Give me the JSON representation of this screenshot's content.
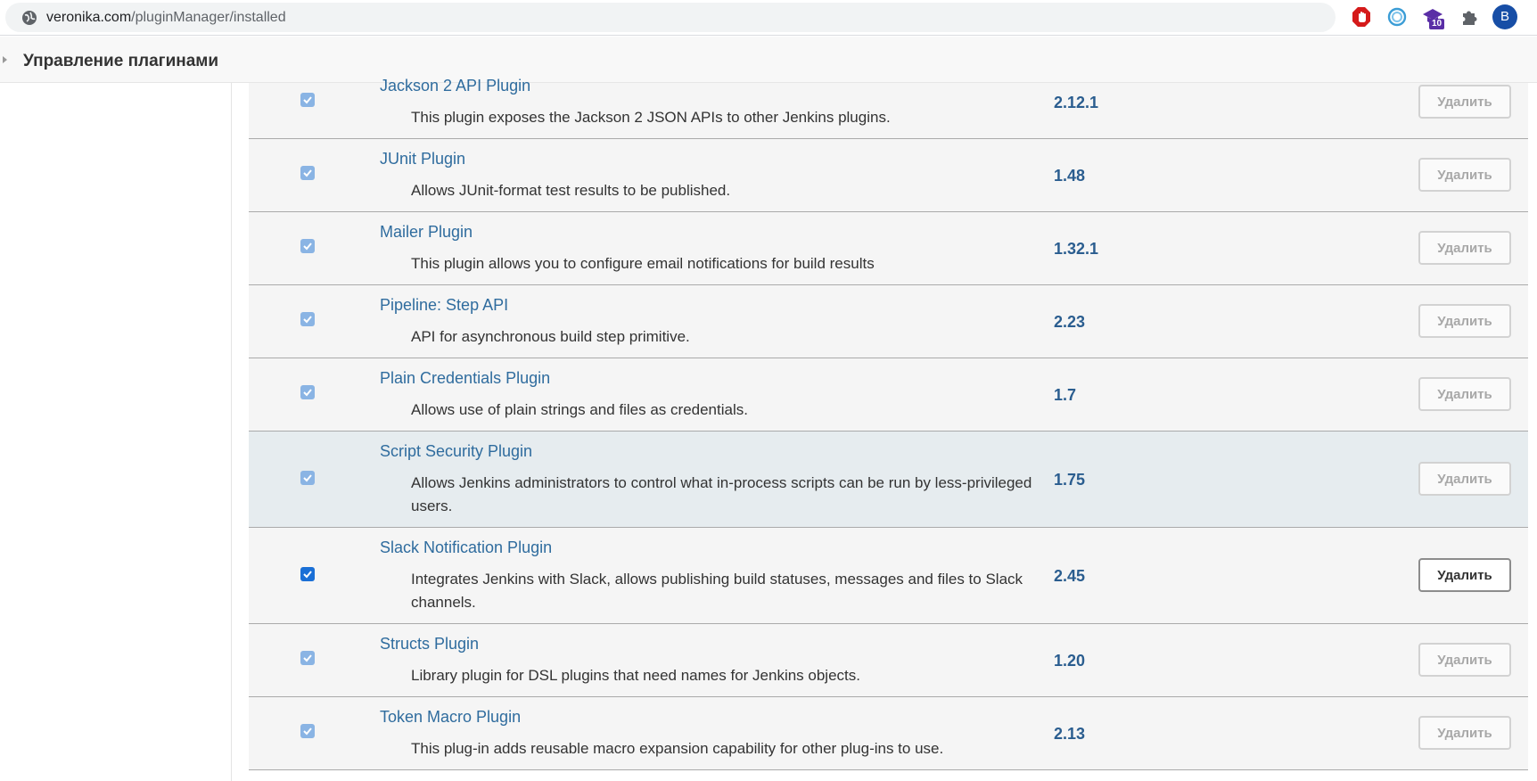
{
  "browser": {
    "url_host": "veronika.com",
    "url_path": "/pluginManager/installed",
    "ext_badge": "10",
    "profile_initial": "B"
  },
  "header": {
    "title": "Управление плагинами"
  },
  "plugins": [
    {
      "name": "Jackson 2 API Plugin",
      "description": "This plugin exposes the Jackson 2 JSON APIs to other Jenkins plugins.",
      "version": "2.12.1",
      "uninstall_label": "Удалить",
      "checked": true,
      "enabled": false
    },
    {
      "name": "JUnit Plugin",
      "description": "Allows JUnit-format test results to be published.",
      "version": "1.48",
      "uninstall_label": "Удалить",
      "checked": true,
      "enabled": false
    },
    {
      "name": "Mailer Plugin",
      "description": "This plugin allows you to configure email notifications for build results",
      "version": "1.32.1",
      "uninstall_label": "Удалить",
      "checked": true,
      "enabled": false
    },
    {
      "name": "Pipeline: Step API",
      "description": "API for asynchronous build step primitive.",
      "version": "2.23",
      "uninstall_label": "Удалить",
      "checked": true,
      "enabled": false
    },
    {
      "name": "Plain Credentials Plugin",
      "description": "Allows use of plain strings and files as credentials.",
      "version": "1.7",
      "uninstall_label": "Удалить",
      "checked": true,
      "enabled": false
    },
    {
      "name": "Script Security Plugin",
      "description": "Allows Jenkins administrators to control what in-process scripts can be run by less-privileged users.",
      "version": "1.75",
      "uninstall_label": "Удалить",
      "checked": true,
      "enabled": false
    },
    {
      "name": "Slack Notification Plugin",
      "description": "Integrates Jenkins with Slack, allows publishing build statuses, messages and files to Slack channels.",
      "version": "2.45",
      "uninstall_label": "Удалить",
      "checked": true,
      "enabled": true
    },
    {
      "name": "Structs Plugin",
      "description": "Library plugin for DSL plugins that need names for Jenkins objects.",
      "version": "1.20",
      "uninstall_label": "Удалить",
      "checked": true,
      "enabled": false
    },
    {
      "name": "Token Macro Plugin",
      "description": "This plug-in adds reusable macro expansion capability for other plug-ins to use.",
      "version": "2.13",
      "uninstall_label": "Удалить",
      "checked": true,
      "enabled": false
    }
  ]
}
